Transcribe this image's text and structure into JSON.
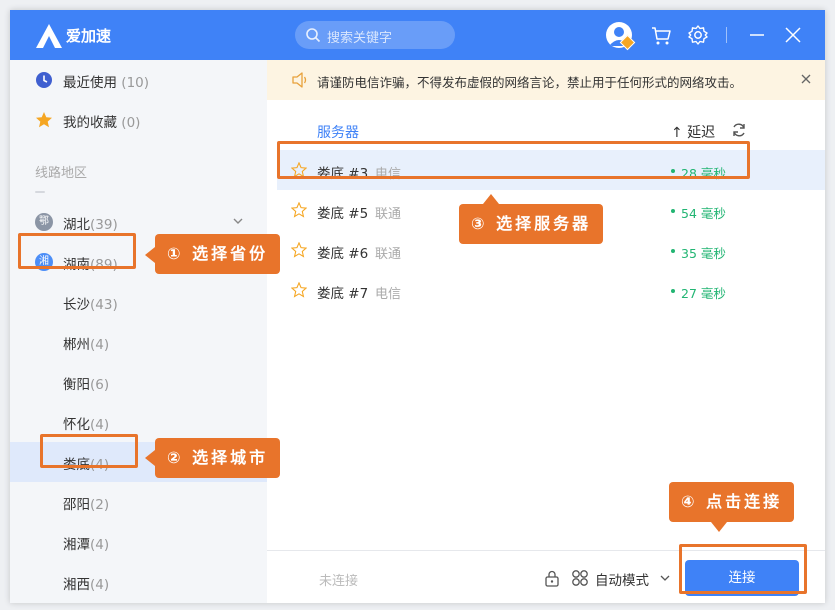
{
  "app": {
    "name": "爱加速"
  },
  "search": {
    "placeholder": "搜索关键字"
  },
  "sidebar": {
    "recent": {
      "label": "最近使用",
      "count": "(10)"
    },
    "favorites": {
      "label": "我的收藏",
      "count": "(0)"
    },
    "section_title": "线路地区",
    "provinces": [
      {
        "badge": "鄂",
        "label": "湖北",
        "count": "(39)"
      },
      {
        "badge": "湘",
        "label": "湖南",
        "count": "(89)"
      }
    ],
    "cities": [
      {
        "label": "长沙",
        "count": "(43)"
      },
      {
        "label": "郴州",
        "count": "(4)"
      },
      {
        "label": "衡阳",
        "count": "(6)"
      },
      {
        "label": "怀化",
        "count": "(4)"
      },
      {
        "label": "娄底",
        "count": "(4)"
      },
      {
        "label": "邵阳",
        "count": "(2)"
      },
      {
        "label": "湘潭",
        "count": "(4)"
      },
      {
        "label": "湘西",
        "count": "(4)"
      }
    ]
  },
  "notice": {
    "text": "请谨防电信诈骗，不得发布虚假的网络言论，禁止用于任何形式的网络攻击。"
  },
  "table": {
    "col_server": "服务器",
    "col_latency": "↑ 延迟"
  },
  "servers": [
    {
      "name": "娄底 #3",
      "isp": "电信",
      "latency": "28 毫秒"
    },
    {
      "name": "娄底 #5",
      "isp": "联通",
      "latency": "54 毫秒"
    },
    {
      "name": "娄底 #6",
      "isp": "联通",
      "latency": "35 毫秒"
    },
    {
      "name": "娄底 #7",
      "isp": "电信",
      "latency": "27 毫秒"
    }
  ],
  "footer": {
    "status": "未连接",
    "mode": "自动模式",
    "connect": "连接"
  },
  "callouts": {
    "step1": "① 选择省份",
    "step2": "② 选择城市",
    "step3": "③ 选择服务器",
    "step4": "④ 点击连接"
  },
  "colors": {
    "brand": "#3f82f7",
    "accent": "#e8742b",
    "latency": "#22b573",
    "notice_bg": "#fdf4e2"
  }
}
